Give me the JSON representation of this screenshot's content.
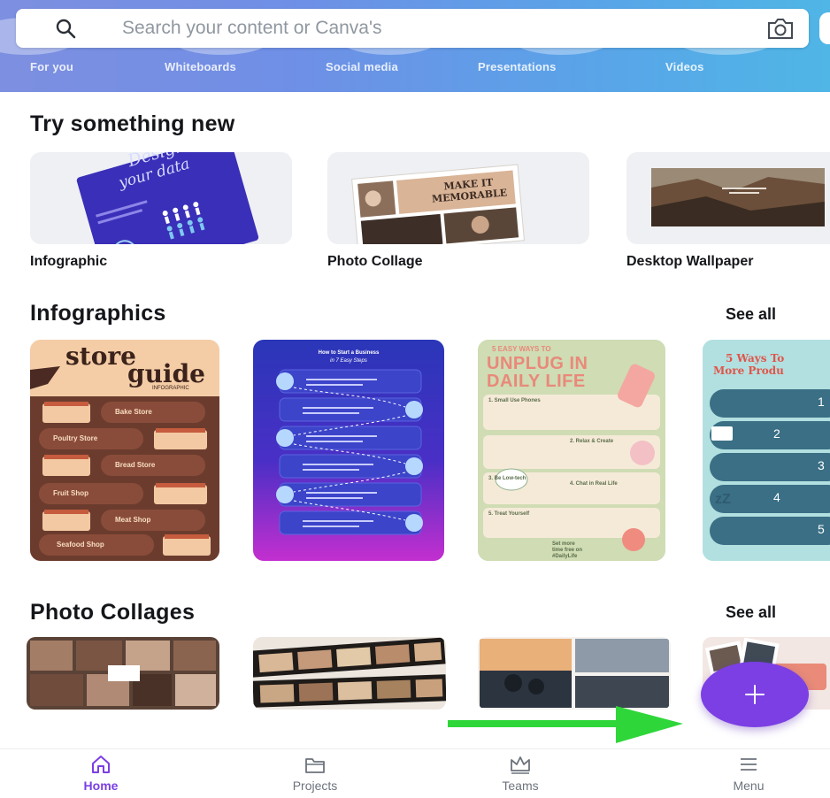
{
  "search": {
    "placeholder": "Search your content or Canva's"
  },
  "categories": [
    "For you",
    "Whiteboards",
    "Social media",
    "Presentations",
    "Videos"
  ],
  "try_section": {
    "title": "Try something new",
    "items": [
      {
        "label": "Infographic",
        "thumb_text": [
          "Design",
          "your data"
        ]
      },
      {
        "label": "Photo Collage",
        "thumb_text": [
          "MAKE IT",
          "MEMORABLE"
        ]
      },
      {
        "label": "Desktop Wallpaper"
      }
    ]
  },
  "infographics_section": {
    "title": "Infographics",
    "see_all": "See all",
    "cards": [
      {
        "title_lines": [
          "store",
          "guide"
        ],
        "subtitle": "INFOGRAPHIC",
        "rows": [
          "Bake Store",
          "Poultry Store",
          "Bread Store",
          "Fruit Shop",
          "Meat Shop",
          "Seafood Shop"
        ]
      },
      {
        "title_lines": [
          "How to Start a Business",
          "in 7 Easy Steps"
        ]
      },
      {
        "title_lines": [
          "5 EASY WAYS TO",
          "UNPLUG IN",
          "DAILY LIFE"
        ],
        "rows": [
          "1. Small Use Phones",
          "2. Relax & Create",
          "3. Be Low-tech",
          "4. Chat in Real Life",
          "5. Treat Yourself"
        ],
        "footer": [
          "Set more",
          "time free on",
          "#DailyLife"
        ]
      },
      {
        "title_lines": [
          "5 Ways To",
          "More Produ"
        ],
        "numbers": [
          "1",
          "2",
          "3",
          "4",
          "5"
        ],
        "zz": "zZ"
      }
    ]
  },
  "collages_section": {
    "title": "Photo Collages",
    "see_all": "See all",
    "card_count": 4
  },
  "fab": {
    "label": "+"
  },
  "bottom_nav": [
    {
      "label": "Home",
      "icon": "home-icon",
      "active": true
    },
    {
      "label": "Projects",
      "icon": "folder-icon",
      "active": false
    },
    {
      "label": "Teams",
      "icon": "crown-icon",
      "active": false
    },
    {
      "label": "Menu",
      "icon": "hamburger-menu-icon",
      "active": false
    }
  ],
  "colors": {
    "brand_purple": "#7b3fe4",
    "arrow_green": "#2fd63a",
    "header_gradient_start": "#7d8fe0",
    "header_gradient_end": "#4fb6e6"
  }
}
